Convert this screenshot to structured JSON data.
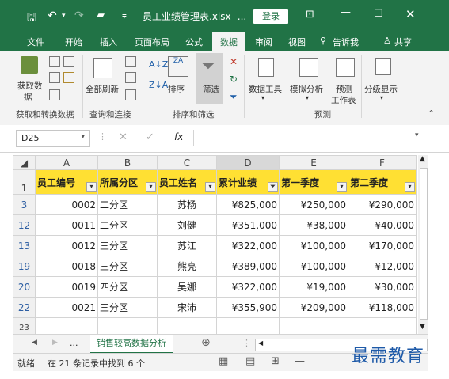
{
  "window": {
    "title": "员工业绩管理表.xlsx -...",
    "login_label": "登录"
  },
  "ribbon_tabs": [
    "文件",
    "开始",
    "插入",
    "页面布局",
    "公式",
    "数据",
    "审阅",
    "视图",
    "告诉我",
    "共享"
  ],
  "active_tab": "数据",
  "ribbon": {
    "get_data": "获取数",
    "get_data_2": "据",
    "refresh_all": "全部刷新",
    "sort": "排序",
    "filter": "筛选",
    "data_tools": "数据工具",
    "what_if": "模拟分析",
    "forecast": "预测",
    "forecast_sheet": "工作表",
    "outline": "分级显示",
    "groups": [
      "获取和转换数据",
      "查询和连接",
      "排序和筛选",
      "预测"
    ]
  },
  "formula_bar": {
    "name_box": "D25",
    "fx": "fx",
    "value": ""
  },
  "columns": [
    "A",
    "B",
    "C",
    "D",
    "E",
    "F"
  ],
  "header_row": {
    "row_num": "1",
    "cells": [
      "员工编号",
      "所属分区",
      "员工姓名",
      "累计业绩",
      "第一季度",
      "第二季度"
    ]
  },
  "rows": [
    {
      "row_num": "3",
      "cells": [
        "0002",
        "二分区",
        "苏杨",
        "¥825,000",
        "¥250,000",
        "¥290,000"
      ]
    },
    {
      "row_num": "12",
      "cells": [
        "0011",
        "二分区",
        "刘健",
        "¥351,000",
        "¥38,000",
        "¥40,000"
      ]
    },
    {
      "row_num": "13",
      "cells": [
        "0012",
        "三分区",
        "苏江",
        "¥322,000",
        "¥100,000",
        "¥170,000"
      ]
    },
    {
      "row_num": "19",
      "cells": [
        "0018",
        "三分区",
        "熊亮",
        "¥389,000",
        "¥100,000",
        "¥12,000"
      ]
    },
    {
      "row_num": "20",
      "cells": [
        "0019",
        "四分区",
        "吴娜",
        "¥322,000",
        "¥19,000",
        "¥30,000"
      ]
    },
    {
      "row_num": "22",
      "cells": [
        "0021",
        "三分区",
        "宋沛",
        "¥355,900",
        "¥209,000",
        "¥118,000"
      ]
    }
  ],
  "empty_row_num": "23",
  "sheet_tab": "销售较高数据分析",
  "sheet_ellipsis": "...",
  "status": {
    "mode": "就绪",
    "message": "在 21 条记录中找到 6 个"
  },
  "watermark": "最需教育",
  "colors": {
    "excel_green": "#217346",
    "header_fill": "#ffe033"
  }
}
